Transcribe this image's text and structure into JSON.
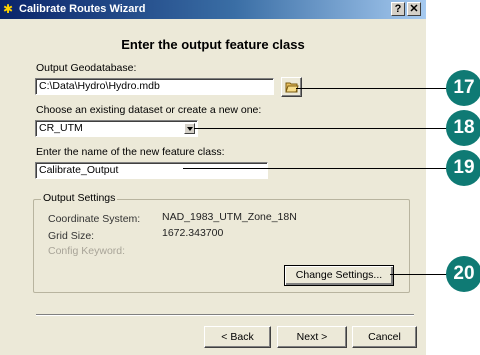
{
  "window": {
    "title": "Calibrate Routes Wizard",
    "help_label": "?",
    "close_label": "✕"
  },
  "heading": "Enter the output feature class",
  "geodatabase": {
    "label": "Output Geodatabase:",
    "value": "C:\\Data\\Hydro\\Hydro.mdb"
  },
  "dataset": {
    "label": "Choose an existing dataset or create a new one:",
    "value": "CR_UTM"
  },
  "feature_class": {
    "label": "Enter the name of the new feature class:",
    "value": "Calibrate_Output"
  },
  "output_settings": {
    "legend": "Output Settings",
    "coordinate_system_label": "Coordinate System:",
    "coordinate_system_value": "NAD_1983_UTM_Zone_18N",
    "grid_size_label": "Grid Size:",
    "grid_size_value": "1672.343700",
    "config_keyword_label": "Config Keyword:",
    "change_settings_label": "Change Settings..."
  },
  "footer": {
    "back_label": "< Back",
    "next_label": "Next >",
    "cancel_label": "Cancel"
  },
  "callouts": [
    "17",
    "18",
    "19",
    "20"
  ],
  "colors": {
    "callout": "#0f7a74",
    "title_start": "#0a246a",
    "title_end": "#a6caf0",
    "dialog_bg": "#ece9d8"
  }
}
